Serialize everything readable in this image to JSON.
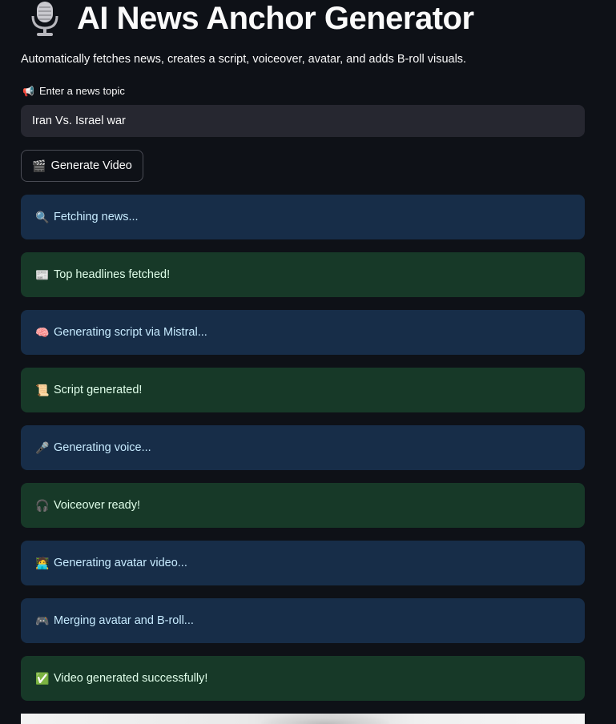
{
  "header": {
    "title": "AI News Anchor Generator",
    "icon": "microphone-icon"
  },
  "subtitle": "Automatically fetches news, creates a script, voiceover, avatar, and adds B-roll visuals.",
  "topic_input": {
    "label_emoji": "📢",
    "label": "Enter a news topic",
    "value": "Iran Vs. Israel war"
  },
  "generate_button": {
    "emoji": "🎬",
    "label": "Generate Video"
  },
  "status_messages": [
    {
      "type": "info",
      "emoji": "🔍",
      "text": "Fetching news..."
    },
    {
      "type": "success",
      "emoji": "📰",
      "text": "Top headlines fetched!"
    },
    {
      "type": "info",
      "emoji": "🧠",
      "text": "Generating script via Mistral..."
    },
    {
      "type": "success",
      "emoji": "📜",
      "text": "Script generated!"
    },
    {
      "type": "info",
      "emoji": "🎤",
      "text": "Generating voice..."
    },
    {
      "type": "success",
      "emoji": "🎧",
      "text": "Voiceover ready!"
    },
    {
      "type": "info",
      "emoji": "🧑‍💻",
      "text": "Generating avatar video..."
    },
    {
      "type": "info",
      "emoji": "🎮",
      "text": "Merging avatar and B-roll..."
    },
    {
      "type": "success",
      "emoji": "✅",
      "text": "Video generated successfully!"
    }
  ],
  "colors": {
    "background": "#0e1117",
    "info_bg": "#172d48",
    "info_text": "#c7ebff",
    "success_bg": "#173928",
    "success_text": "#dffde9",
    "input_bg": "#262730"
  }
}
